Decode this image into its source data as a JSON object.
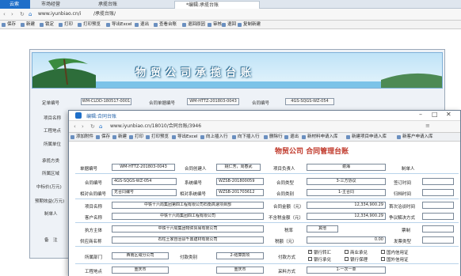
{
  "tabs": [
    {
      "label": "云索"
    },
    {
      "label": "市场经营"
    },
    {
      "label": "承揽台账"
    },
    {
      "label": "*编辑:承揽台账"
    }
  ],
  "address": {
    "url": "www.iyunbiao.cn/i",
    "path": "/承揽台账/"
  },
  "toolbar1": [
    "保存",
    "新建",
    "锁定",
    "打印",
    "打印预览",
    "导出Excel",
    "退出",
    "查看台账",
    "退回原因",
    "审核",
    "退回",
    "复制新建"
  ],
  "banner": {
    "title": "物贸公司承揽台账"
  },
  "form1": {
    "labels": [
      "定单编号",
      "项目名称",
      "工程地点",
      "所属单位",
      "承揽方类",
      "所属区域",
      "中标价(万元)",
      "预期效益(万元)",
      "制单人",
      "备　注"
    ],
    "order_no": "WM-CLDD-180517-0001",
    "contract_no_label": "合同单据编号",
    "contract_no": "WM-HTTZ-201803-0043",
    "contract_code_label": "合同编号",
    "contract_code": "4GS-SQGS-WZ-054"
  },
  "win2": {
    "tab": "编辑:合同台账",
    "url": "www.iyunbiao.cn/18010/合同台账/3946",
    "toolbar": [
      "添加附件",
      "保存",
      "新建",
      "打印",
      "打印预览",
      "导出Excel",
      "向上插入行",
      "向下插入行",
      "删除行",
      "退出",
      "新材料申请入库",
      "新建项目申请入库",
      "新客户申请入库"
    ],
    "heading": "物贸公司 合同管理台账",
    "row0": {
      "l1": "单据编号",
      "v1": "WM-HTTZ-201803-0043",
      "l2": "合同创建人",
      "v2": "姚仁芳，周春武",
      "l3": "项目负责人",
      "v3": "谢海",
      "l4": "制单人"
    },
    "rows": [
      {
        "a": "合同编号",
        "av": "4GS-SQGS-WZ-054",
        "b": "系统编号",
        "bv": "WZSB-201800059",
        "c": "合同类型",
        "cv": "3-三方协议",
        "d": "签订时间"
      },
      {
        "a": "相对合同编号",
        "av": "无合同编号",
        "b": "相对系统编号",
        "bv": "WZSB-201703612",
        "c": "合同类别",
        "cv": "1-主合同",
        "d": "归档时间"
      },
      {
        "a": "项目名称",
        "av": "中铁十六局集团第四工程有限公司石衡高速项目部",
        "c": "合同金额（元）",
        "cv": "12,334,900.29",
        "d": "首次洽谈时间"
      },
      {
        "a": "客户名称",
        "av": "中铁十六局集团四工程有限公司",
        "c": "不含税金额（元）",
        "cv": "12,334,900.29",
        "d": "争议解决方式"
      },
      {
        "a": "执方主体",
        "av": "中铁十六局集团物资贸易有限公司",
        "c": "税率",
        "cv": "其他",
        "d": "票制"
      },
      {
        "a": "供应商名称",
        "av": "石柱土家自治县千鼎建材有限公司",
        "c": "税额（元）",
        "cv": "0.00",
        "d": "发票类型"
      },
      {
        "a": "所属部门",
        "av": "西南区域分公司",
        "b": "付款类别",
        "bv": "2-结算款项",
        "c": "付款方式",
        "d": ""
      },
      {
        "a": "工程地点",
        "av": "重庆市",
        "b": "",
        "bv": "重庆市",
        "c": "采料方式",
        "cv": "1-一次一单"
      }
    ],
    "pay_opts": [
      "银行转汇",
      "商业承兑",
      "国内信用证",
      "银行承兑",
      "银行保理",
      "国外信用证"
    ]
  }
}
